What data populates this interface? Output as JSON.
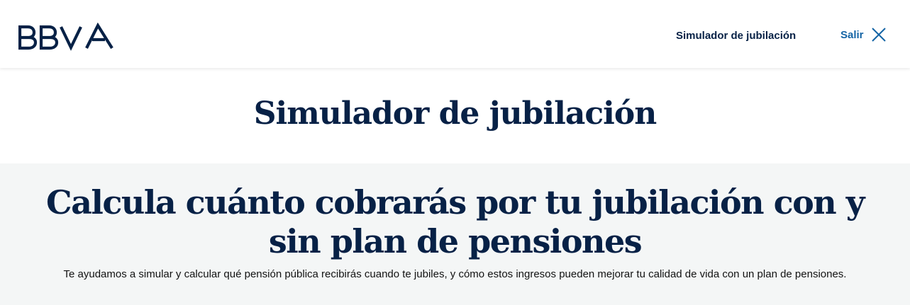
{
  "header": {
    "logo_text": "BBVA",
    "nav_title": "Simulador de jubilación",
    "exit_label": "Salir",
    "exit_icon": "close-icon",
    "brand_color": "#072146",
    "link_color": "#1464a5"
  },
  "page": {
    "title": "Simulador de jubilación"
  },
  "hero": {
    "heading": "Calcula cuánto cobrarás por tu jubilación con y sin plan de pensiones",
    "description": "Te ayudamos a simular y calcular qué pensión pública recibirás cuando te jubiles, y cómo estos ingresos pueden mejorar tu calidad de vida con un plan de pensiones.",
    "background": "#f4f6f6"
  }
}
